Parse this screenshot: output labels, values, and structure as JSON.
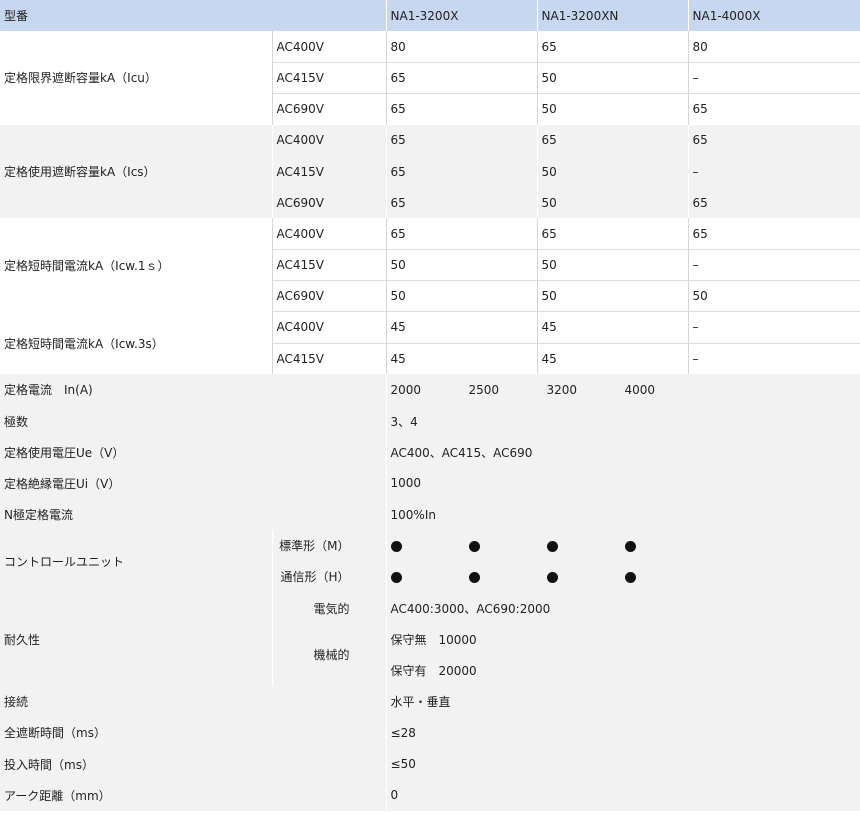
{
  "header": {
    "label": "型番",
    "models": [
      "NA1-3200X",
      "NA1-3200XN",
      "NA1-4000X"
    ]
  },
  "icu": {
    "label": "定格限界遮断容量kA（Icu）",
    "rows": [
      {
        "v": "AC400V",
        "vals": [
          "80",
          "65",
          "80"
        ]
      },
      {
        "v": "AC415V",
        "vals": [
          "65",
          "50",
          "–"
        ]
      },
      {
        "v": "AC690V",
        "vals": [
          "65",
          "50",
          "65"
        ]
      }
    ]
  },
  "ics": {
    "label": "定格使用遮断容量kA（Ics）",
    "rows": [
      {
        "v": "AC400V",
        "vals": [
          "65",
          "65",
          "65"
        ]
      },
      {
        "v": "AC415V",
        "vals": [
          "65",
          "50",
          "–"
        ]
      },
      {
        "v": "AC690V",
        "vals": [
          "65",
          "50",
          "65"
        ]
      }
    ]
  },
  "icw1": {
    "label": "定格短時間電流kA（Icw.1ｓ）",
    "rows": [
      {
        "v": "AC400V",
        "vals": [
          "65",
          "65",
          "65"
        ]
      },
      {
        "v": "AC415V",
        "vals": [
          "50",
          "50",
          "–"
        ]
      },
      {
        "v": "AC690V",
        "vals": [
          "50",
          "50",
          "50"
        ]
      }
    ]
  },
  "icw3": {
    "label": "定格短時間電流kA（Icw.3s）",
    "rows": [
      {
        "v": "AC400V",
        "vals": [
          "45",
          "45",
          "–"
        ]
      },
      {
        "v": "AC415V",
        "vals": [
          "45",
          "45",
          "–"
        ]
      }
    ]
  },
  "rated_current": {
    "label": "定格電流　In(A)",
    "values": [
      "2000",
      "2500",
      "3200",
      "4000"
    ]
  },
  "poles": {
    "label": "極数",
    "value": "3、4"
  },
  "ue": {
    "label": "定格使用電圧Ue（V）",
    "value": "AC400、AC415、AC690"
  },
  "ui": {
    "label": "定格絶縁電圧Ui（V）",
    "value": "1000"
  },
  "n_pole": {
    "label": "N極定格電流",
    "value": "100%In"
  },
  "control": {
    "label": "コントロールユニット",
    "standard": "標準形（M）",
    "comm": "通信形（H）"
  },
  "durability": {
    "label": "耐久性",
    "electrical": "電気的",
    "electrical_value": "AC400:3000、AC690:2000",
    "mechanical": "機械的",
    "mech_values": [
      "保守無　10000",
      "保守有　20000"
    ]
  },
  "connection": {
    "label": "接続",
    "value": "水平・垂直"
  },
  "break_time": {
    "label": "全遮断時間（ms）",
    "value": "≤28"
  },
  "close_time": {
    "label": "投入時間（ms）",
    "value": "≤50"
  },
  "arc": {
    "label": "アーク距離（mm）",
    "value": "0"
  }
}
